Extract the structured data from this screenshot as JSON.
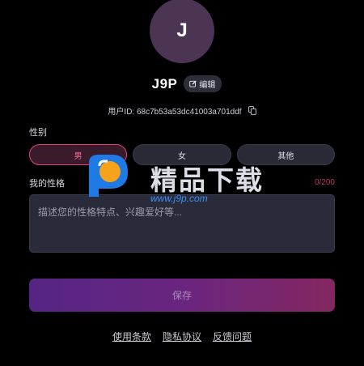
{
  "profile": {
    "avatar_initial": "J",
    "username": "J9P",
    "edit_label": "编辑",
    "user_id_label": "用户ID: 68c7b53a53dc41003a701ddf"
  },
  "gender": {
    "label": "性别",
    "options": [
      "男",
      "女",
      "其他"
    ],
    "selected": "男"
  },
  "personality": {
    "label": "我的性格",
    "counter": "0/200",
    "placeholder": "描述您的性格特点、兴趣爱好等..."
  },
  "save_label": "保存",
  "footer_links": [
    "使用条款",
    "隐私协议",
    "反馈问题"
  ],
  "watermark": {
    "text": "精品下载",
    "url": "www.j9p.com"
  },
  "colors": {
    "accent": "#e0457b",
    "avatar_bg": "#4b3553",
    "save_gradient_start": "#552584",
    "save_gradient_end": "#83275f"
  },
  "icons": {
    "edit": "edit-icon",
    "copy": "copy-icon"
  }
}
